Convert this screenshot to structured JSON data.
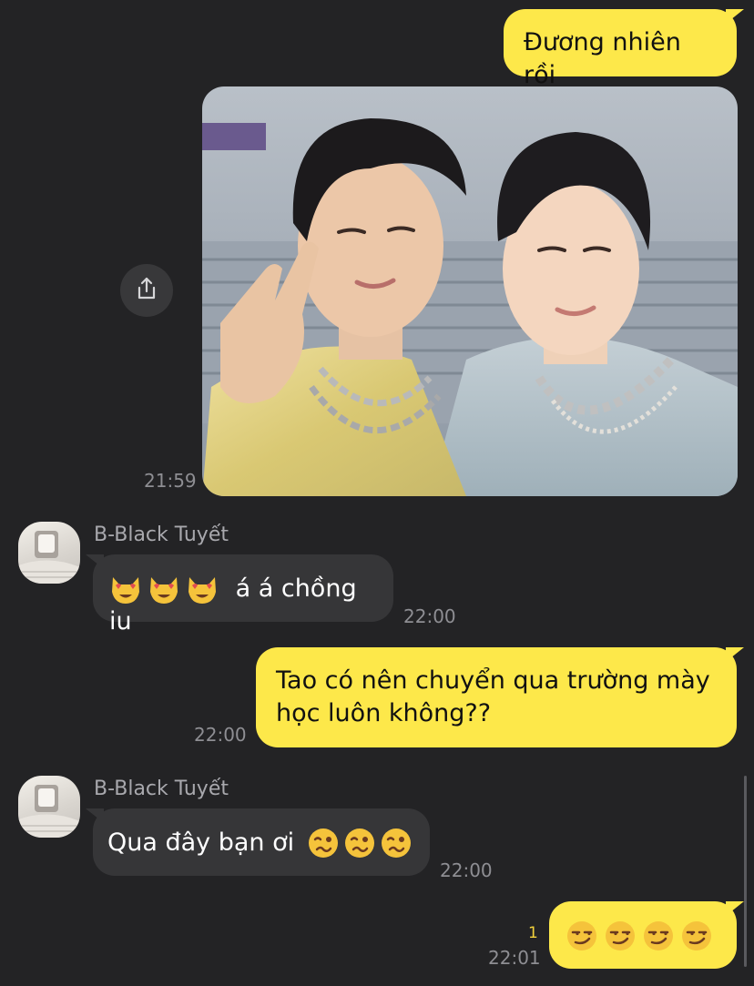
{
  "messages": {
    "m1": {
      "text": "Đương nhiên rồi"
    },
    "m2": {
      "time": "21:59",
      "image_label": "photo-two-people"
    },
    "m3": {
      "sender": "B-Black Tuyết",
      "text": "á á chồng iu",
      "emoji": "smiling-cat-heart-eyes-emoji",
      "emoji_count": 3,
      "time": "22:00"
    },
    "m4": {
      "line1": "Tao có nên chuyển qua trường mày",
      "line2": "học luôn không??",
      "time": "22:00"
    },
    "m5": {
      "sender": "B-Black Tuyết",
      "text": "Qua đây bạn ơi",
      "emoji": "woozy-face-emoji",
      "emoji_count": 3,
      "time": "22:00"
    },
    "m6": {
      "emoji": "smirking-face-emoji",
      "emoji_count": 4,
      "unread": "1",
      "time": "22:01"
    }
  },
  "icons": {
    "share": "share-upload-icon"
  },
  "colors": {
    "background": "#232325",
    "outgoing_bubble": "#fde84a",
    "incoming_bubble": "#363638",
    "timestamp": "#8e8e93",
    "unread_count": "#f3d23c"
  }
}
